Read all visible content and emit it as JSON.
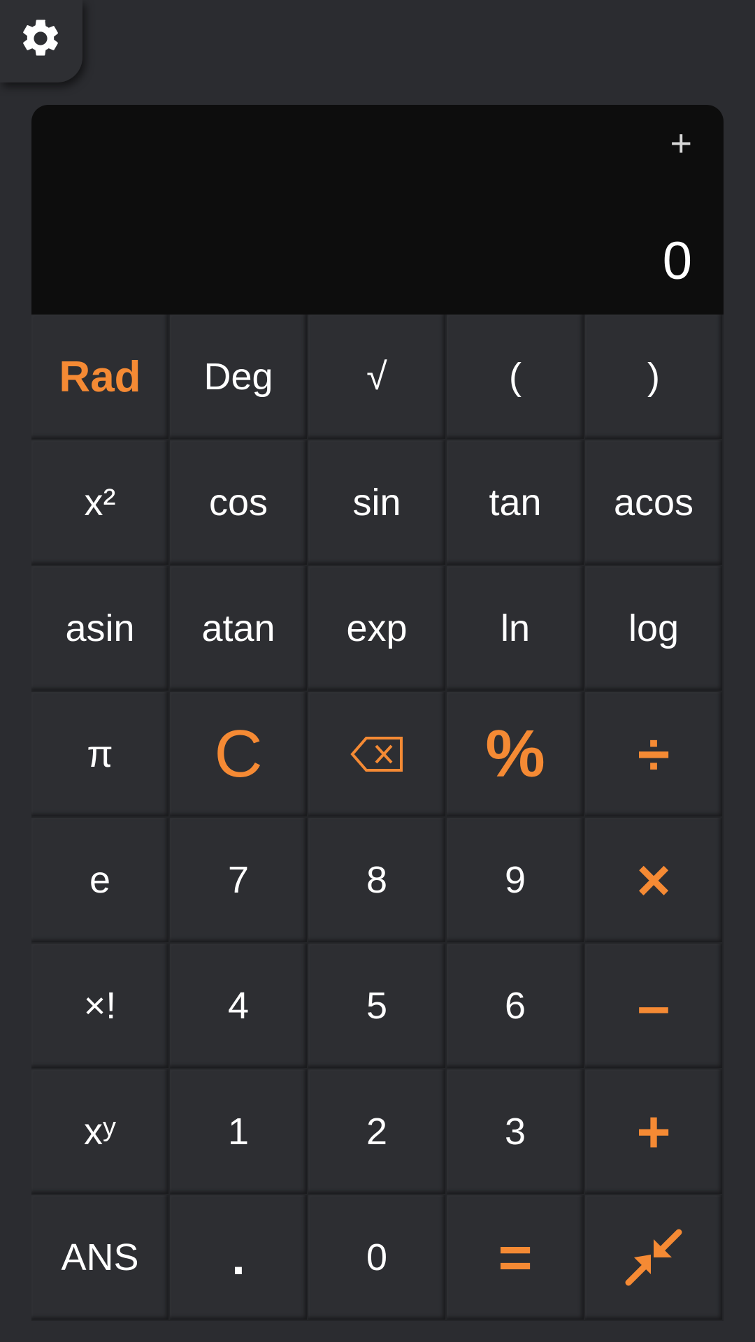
{
  "display": {
    "expand_symbol": "+",
    "result": "0"
  },
  "keys": {
    "rad": "Rad",
    "deg": "Deg",
    "sqrt": "√",
    "paren_open": "(",
    "paren_close": ")",
    "square": "x²",
    "cos": "cos",
    "sin": "sin",
    "tan": "tan",
    "acos": "acos",
    "asin": "asin",
    "atan": "atan",
    "exp": "exp",
    "ln": "ln",
    "log": "log",
    "pi": "π",
    "clear": "C",
    "percent": "%",
    "divide": "÷",
    "e": "e",
    "seven": "7",
    "eight": "8",
    "nine": "9",
    "multiply": "×",
    "factorial": "×!",
    "four": "4",
    "five": "5",
    "six": "6",
    "minus": "–",
    "power_base": "x",
    "power_exp": "y",
    "one": "1",
    "two": "2",
    "three": "3",
    "plus": "+",
    "ans": "ANS",
    "dot": ".",
    "zero": "0",
    "equals": "="
  },
  "icons": {
    "settings": "gear-icon",
    "backspace": "backspace-icon",
    "collapse": "collapse-arrows-icon"
  },
  "colors": {
    "accent": "#f58a34",
    "background": "#2b2c30",
    "display_bg": "#0d0d0d",
    "text": "#ffffff"
  }
}
